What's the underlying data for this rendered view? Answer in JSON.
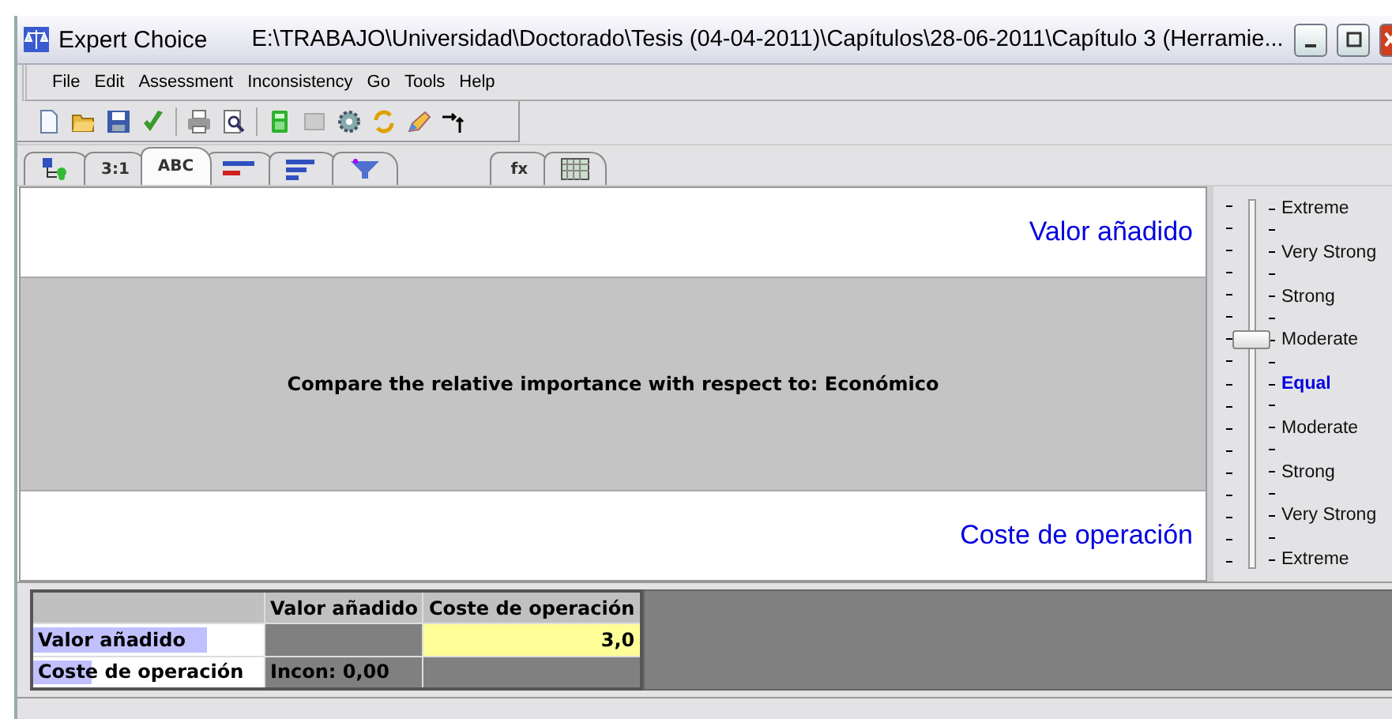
{
  "window": {
    "app": "Expert Choice",
    "path": "E:\\TRABAJO\\Universidad\\Doctorado\\Tesis (04-04-2011)\\Capítulos\\28-06-2011\\Capítulo 3 (Herramie..."
  },
  "menu": [
    {
      "label": "File"
    },
    {
      "label": "Edit"
    },
    {
      "label": "Assessment"
    },
    {
      "label": "Inconsistency"
    },
    {
      "label": "Go"
    },
    {
      "label": "Tools"
    },
    {
      "label": "Help"
    }
  ],
  "toolbar": [
    {
      "kind": "new"
    },
    {
      "kind": "open"
    },
    {
      "kind": "save"
    },
    {
      "kind": "check"
    },
    {
      "kind": "sep"
    },
    {
      "kind": "print"
    },
    {
      "kind": "preview"
    },
    {
      "kind": "sep"
    },
    {
      "kind": "calculator"
    },
    {
      "kind": "disabled"
    },
    {
      "kind": "gear"
    },
    {
      "kind": "refresh"
    },
    {
      "kind": "pencil"
    },
    {
      "kind": "arrows"
    }
  ],
  "tabs": [
    {
      "kind": "tree",
      "selected": false
    },
    {
      "kind": "text",
      "label": "3:1",
      "selected": false
    },
    {
      "kind": "text",
      "label": "ABC",
      "selected": true
    },
    {
      "kind": "bars2",
      "selected": false
    },
    {
      "kind": "bars3",
      "selected": false
    },
    {
      "kind": "funnel",
      "selected": false
    },
    {
      "kind": "gap"
    },
    {
      "kind": "text",
      "label": "fx",
      "selected": false
    },
    {
      "kind": "grid",
      "selected": false
    }
  ],
  "comparison": {
    "top": "Valor añadido",
    "question": "Compare the relative importance with respect to: Económico",
    "bottom": "Coste de operación"
  },
  "scale": {
    "labels": [
      "Extreme",
      "Very Strong",
      "Strong",
      "Moderate",
      "Equal",
      "Moderate",
      "Strong",
      "Very Strong",
      "Extreme"
    ],
    "level": 0.625
  },
  "matrix": {
    "columns": [
      "Valor añadido",
      "Coste de operación"
    ],
    "rows": [
      {
        "name": "Valor añadido",
        "level": 0.75,
        "cells": [
          {
            "kind": "diag"
          },
          {
            "kind": "value",
            "text": "3,0"
          }
        ]
      },
      {
        "name": "Coste de operación",
        "level": 0.25,
        "cells": [
          {
            "kind": "incon",
            "text": "Incon: 0,00"
          },
          {
            "kind": "diag"
          }
        ]
      }
    ]
  }
}
